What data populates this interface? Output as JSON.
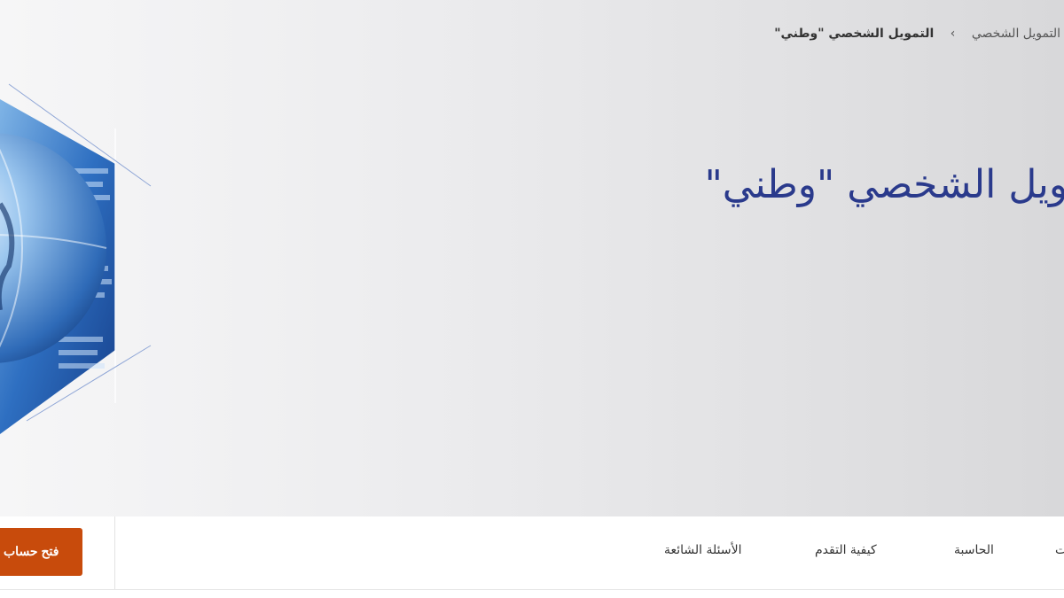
{
  "breadcrumb": {
    "items": [
      "التمويل الشخصي",
      "التمويل الشخصي \"وطني\""
    ],
    "separator": "›"
  },
  "hero": {
    "title": "التمويل الشخصي \"وطني\""
  },
  "tabs": {
    "items": [
      {
        "label": "الحاسبة"
      },
      {
        "label": "كيفية التقدم"
      },
      {
        "label": "الأسئلة الشائعة"
      }
    ],
    "partial_label": "المميزات"
  },
  "cta": {
    "label": "فتح حساب"
  },
  "colors": {
    "title": "#2a3a8c",
    "cta": "#c84b0c",
    "hero_bg": "#e6e6e8"
  }
}
